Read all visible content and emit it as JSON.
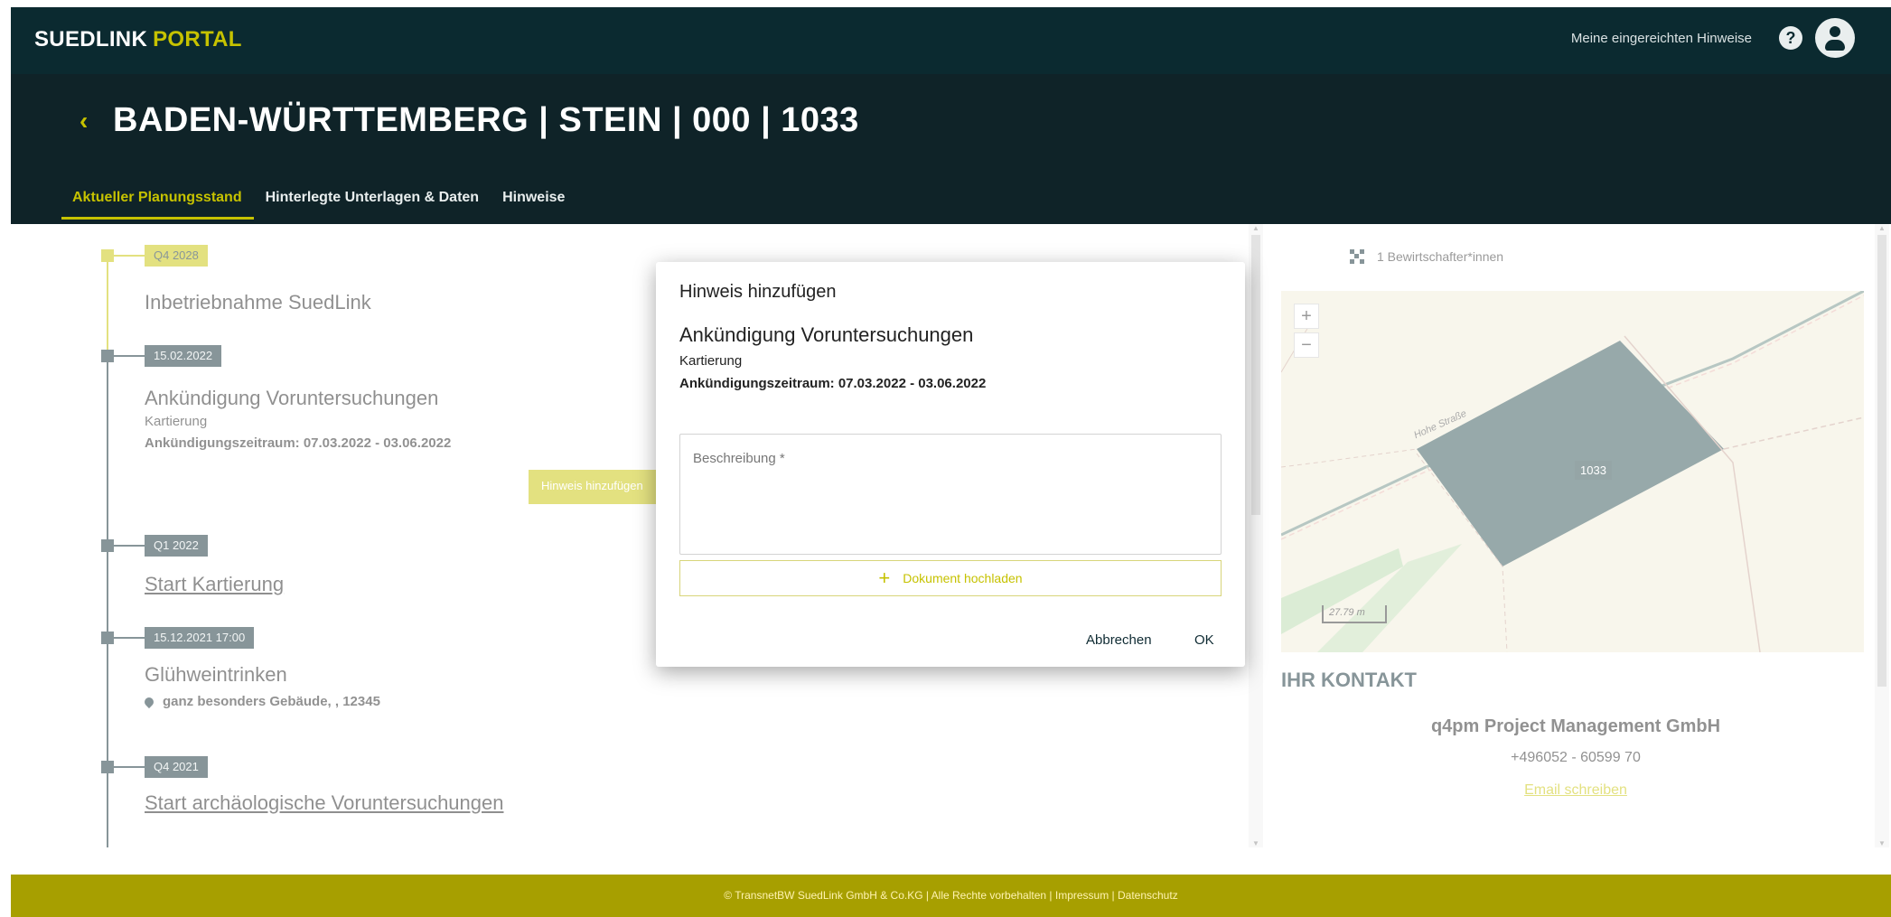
{
  "brand": {
    "part1": "SUEDLINK",
    "part2": "PORTAL"
  },
  "topbar": {
    "my_hints_label": "Meine eingereichten Hinweise",
    "help_glyph": "?"
  },
  "header": {
    "title": "BADEN-WÜRTTEMBERG | STEIN | 000 | 1033",
    "back_glyph": "‹",
    "tabs": [
      {
        "label": "Aktueller Planungsstand",
        "active": true
      },
      {
        "label": "Hinterlegte Unterlagen & Daten",
        "active": false
      },
      {
        "label": "Hinweise",
        "active": false
      }
    ]
  },
  "timeline": {
    "items": [
      {
        "date": "Q4 2028",
        "title": "Inbetriebnahme SuedLink"
      },
      {
        "date": "15.02.2022",
        "title": "Ankündigung Voruntersuchungen",
        "sub": "Kartierung",
        "period": "Ankündigungszeitraum: 07.03.2022 - 03.06.2022"
      },
      {
        "date": "Q1 2022",
        "title": "Start Kartierung"
      },
      {
        "date": "15.12.2021 17:00",
        "title": "Glühweintrinken",
        "location": "ganz besonders Gebäude, , 12345"
      },
      {
        "date": "Q4 2021",
        "title": "Start archäologische Voruntersuchungen"
      }
    ],
    "add_hint_button": "Hinweis hinzufügen"
  },
  "right_panel": {
    "owners": "1 Bewirtschafter*innen",
    "map": {
      "parcel": "1033",
      "street": "Hohe Straße",
      "scale": "27.79 m",
      "zoom_in": "+",
      "zoom_out": "−"
    },
    "contact": {
      "heading": "IHR KONTAKT",
      "company": "q4pm Project Management GmbH",
      "phone": "+496052 - 60599 70",
      "email_label": "Email schreiben"
    }
  },
  "dialog": {
    "heading": "Hinweis hinzufügen",
    "title": "Ankündigung Voruntersuchungen",
    "sub": "Kartierung",
    "period": "Ankündigungszeitraum: 07.03.2022 - 03.06.2022",
    "description_placeholder": "Beschreibung *",
    "description_value": "",
    "upload_label": "Dokument hochladen",
    "cancel_label": "Abbrechen",
    "ok_label": "OK"
  },
  "footer": {
    "text": "© TransnetBW SuedLink GmbH & Co.KG | Alle Rechte vorbehalten | Impressum | Datenschutz"
  },
  "colors": {
    "dark": "#0b2a30",
    "accent": "#c6c200",
    "footer": "#a79f00"
  }
}
